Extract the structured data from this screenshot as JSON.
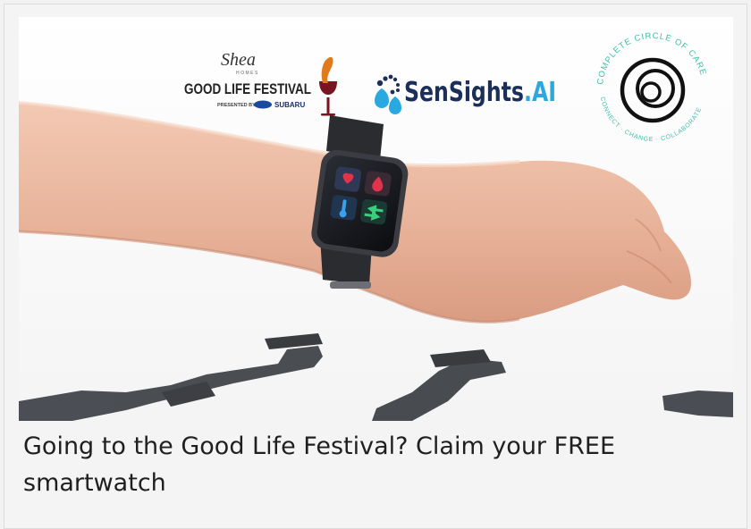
{
  "article": {
    "caption": "Going to the Good Life Festival? Claim your FREE smartwatch"
  },
  "logos": {
    "shea": {
      "script": "Shea",
      "homes": "HOMES",
      "title": "GOOD LIFE FESTIVAL",
      "presented": "PRESENTED BY",
      "sponsor": "SUBARU"
    },
    "sensights": {
      "name_main": "SenSights",
      "name_suffix": ".AI"
    },
    "circle_of_care": {
      "top_text": "COMPLETE CIRCLE OF CARE",
      "bottom_text": "CONNECT · CHANGE · COLLABORATE"
    }
  },
  "colors": {
    "sensights_dark": "#1b2f5b",
    "sensights_accent": "#2aa8e0",
    "festival_wine": "#7a1420",
    "festival_orange": "#e07b1c",
    "care_teal": "#3dbfa6",
    "caption_text": "#1f1f1f"
  },
  "icons": {
    "watch_tiles": [
      "heart-icon",
      "drop-icon",
      "thermometer-icon",
      "sync-icon"
    ]
  }
}
